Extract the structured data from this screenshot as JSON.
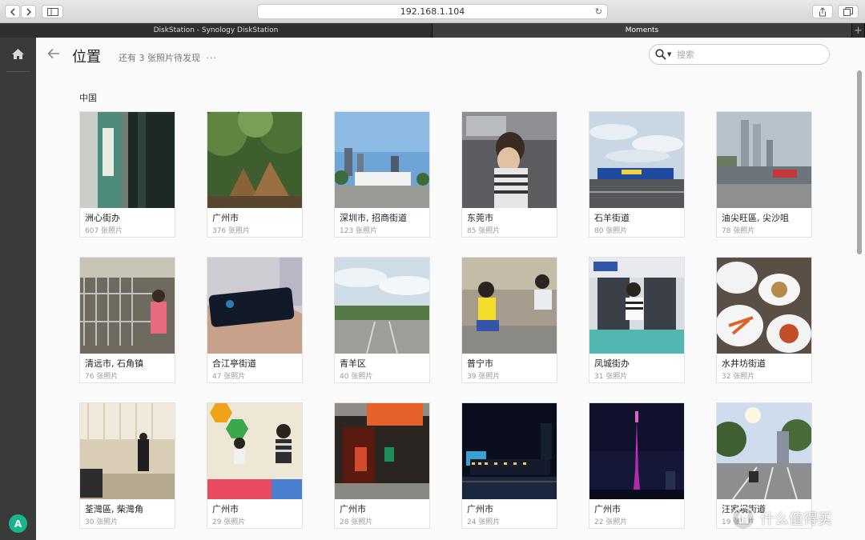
{
  "browser": {
    "url": "192.168.1.104",
    "tabs": [
      {
        "label": "DiskStation - Synology DiskStation"
      },
      {
        "label": "Moments"
      }
    ],
    "new_tab_label": "+"
  },
  "rail": {
    "avatar_letter": "A"
  },
  "header": {
    "title": "位置",
    "pending_text": "还有 3 张照片待发现",
    "more_label": "···"
  },
  "search": {
    "placeholder": "搜索",
    "value": ""
  },
  "section": {
    "title": "中国"
  },
  "places": [
    {
      "name": "洲心街办",
      "count": "607 张照片"
    },
    {
      "name": "广州市",
      "count": "376 张照片"
    },
    {
      "name": "深圳市, 招商街道",
      "count": "123 张照片"
    },
    {
      "name": "东莞市",
      "count": "85 张照片"
    },
    {
      "name": "石羊街道",
      "count": "80 张照片"
    },
    {
      "name": "油尖旺區, 尖沙咀",
      "count": "78 张照片"
    },
    {
      "name": "清远市, 石角镇",
      "count": "76 张照片"
    },
    {
      "name": "合江亭街道",
      "count": "47 张照片"
    },
    {
      "name": "青羊区",
      "count": "40 张照片"
    },
    {
      "name": "普宁市",
      "count": "39 张照片"
    },
    {
      "name": "凤城街办",
      "count": "31 张照片"
    },
    {
      "name": "水井坊街道",
      "count": "32 张照片"
    },
    {
      "name": "荃灣區, 柴灣角",
      "count": "30 张照片"
    },
    {
      "name": "广州市",
      "count": "29 张照片"
    },
    {
      "name": "广州市",
      "count": "28 张照片"
    },
    {
      "name": "广州市",
      "count": "24 张照片"
    },
    {
      "name": "广州市",
      "count": "22 张照片"
    },
    {
      "name": "汪家坝街道",
      "count": "19 张照片"
    }
  ],
  "watermark": {
    "badge": "值",
    "text": "什么值得买"
  }
}
